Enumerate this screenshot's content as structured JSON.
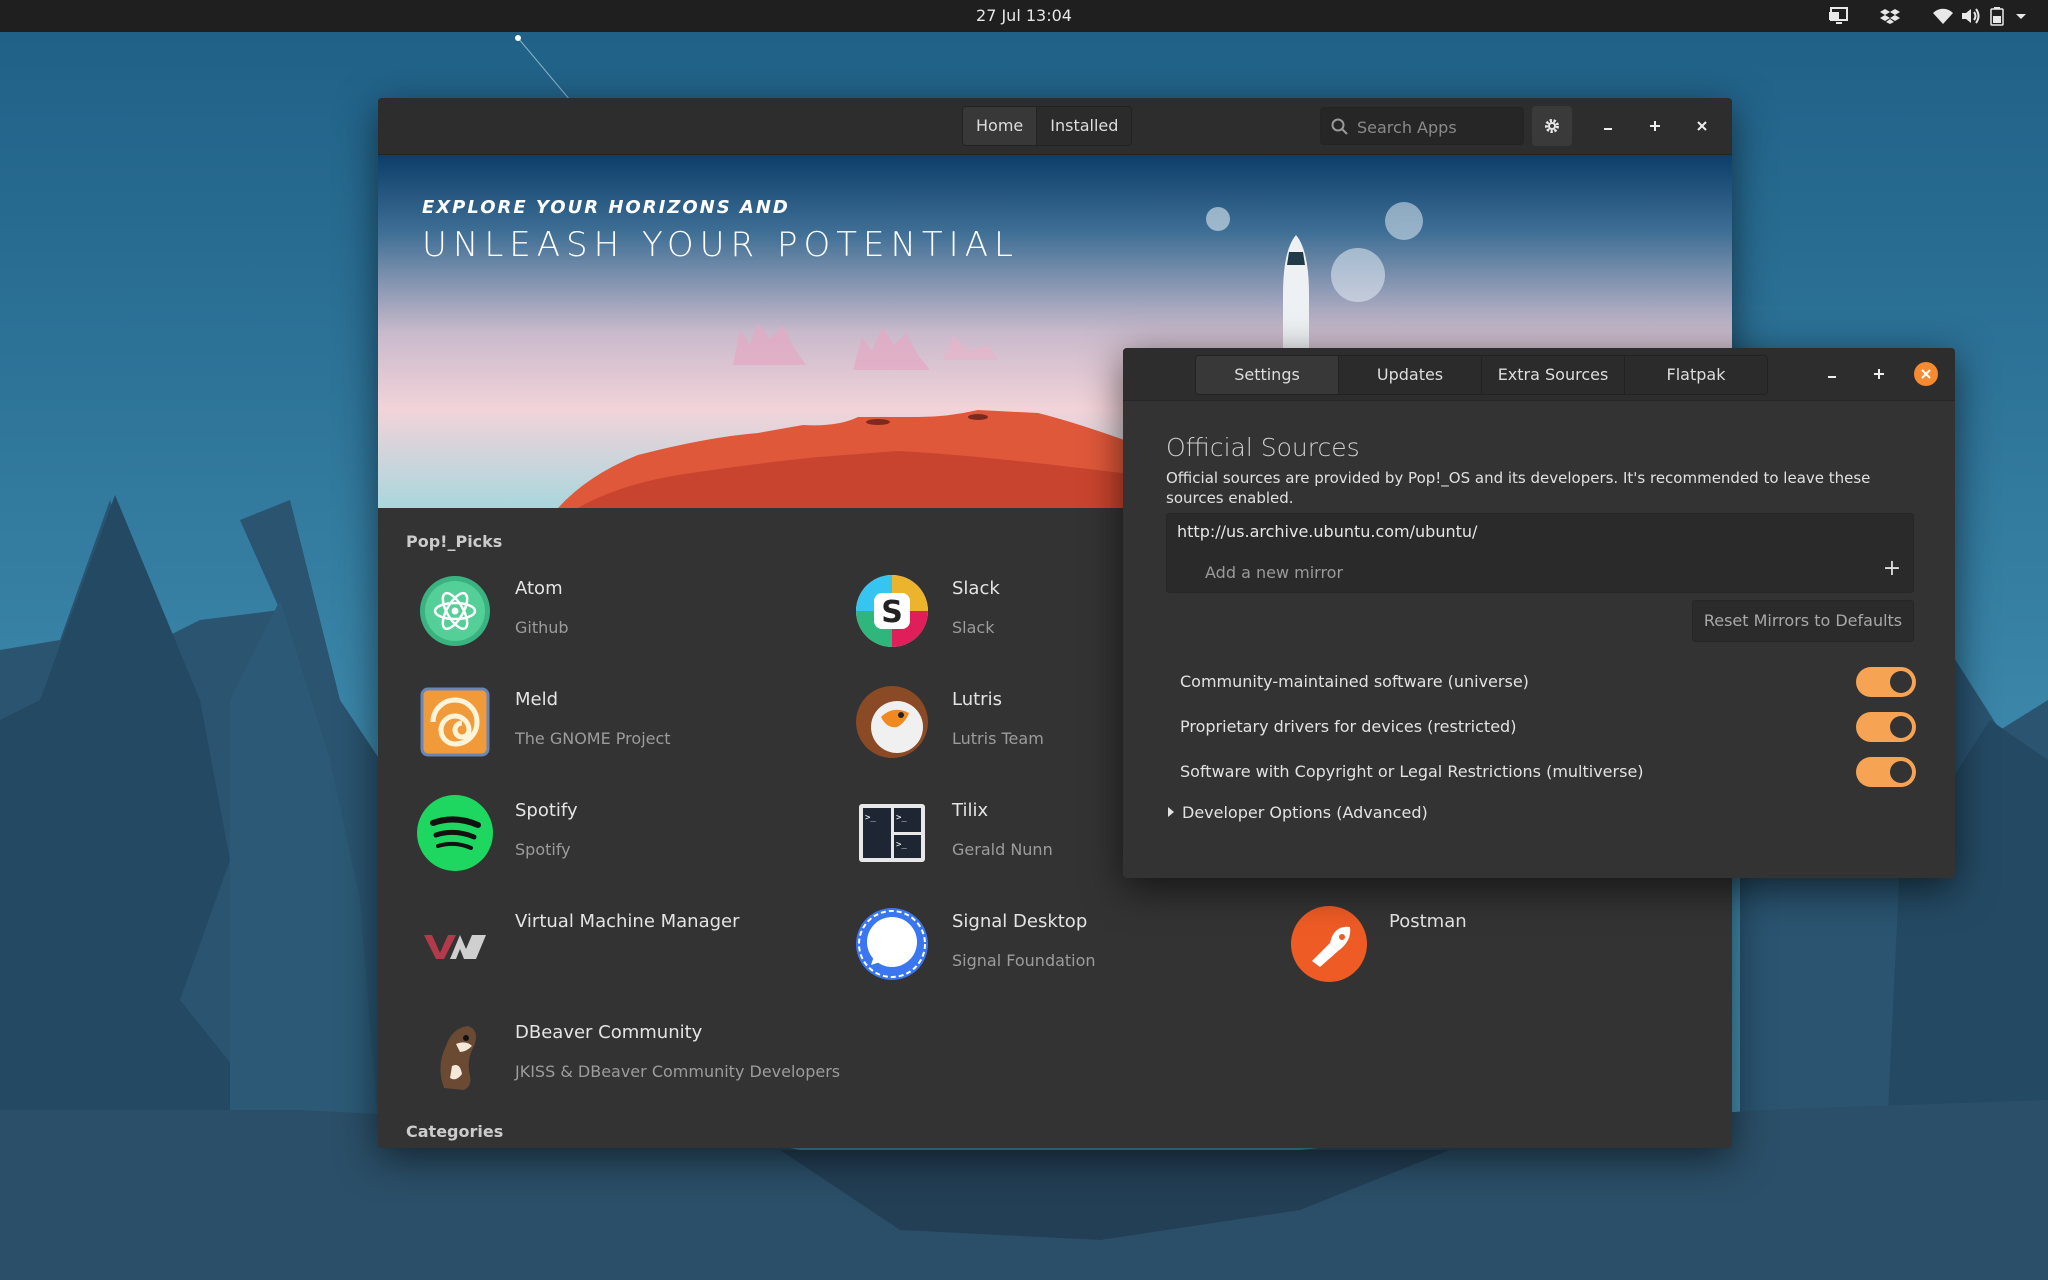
{
  "topbar": {
    "clock": "27 Jul  13:04",
    "icons": [
      "screen-icon",
      "dropbox-icon",
      "wifi-icon",
      "volume-icon",
      "battery-icon",
      "chevron-down-icon"
    ]
  },
  "main": {
    "tabs": [
      {
        "label": "Home",
        "active": true
      },
      {
        "label": "Installed",
        "active": false
      }
    ],
    "search_placeholder": "Search Apps",
    "banner": {
      "line1": "EXPLORE YOUR HORIZONS AND",
      "line2": "UNLEASH YOUR POTENTIAL"
    },
    "picks_title": "Pop!_Picks",
    "apps": [
      {
        "name": "Atom",
        "developer": "Github"
      },
      {
        "name": "Slack",
        "developer": "Slack"
      },
      {
        "name": "Meld",
        "developer": "The GNOME Project"
      },
      {
        "name": "Lutris",
        "developer": "Lutris Team"
      },
      {
        "name": "Spotify",
        "developer": "Spotify"
      },
      {
        "name": "Tilix",
        "developer": "Gerald Nunn"
      },
      {
        "name": "Virtual Machine Manager",
        "developer": ""
      },
      {
        "name": "Signal Desktop",
        "developer": "Signal Foundation"
      },
      {
        "name": "Postman",
        "developer": ""
      },
      {
        "name": "DBeaver Community",
        "developer": "JKISS & DBeaver Community Developers"
      }
    ],
    "categories_title": "Categories"
  },
  "settings": {
    "tabs": [
      {
        "label": "Settings",
        "active": true
      },
      {
        "label": "Updates",
        "active": false
      },
      {
        "label": "Extra Sources",
        "active": false
      },
      {
        "label": "Flatpak",
        "active": false
      }
    ],
    "title": "Official Sources",
    "description": "Official sources are provided by Pop!_OS and its developers. It's recommended to leave these sources enabled.",
    "mirror_url": "http://us.archive.ubuntu.com/ubuntu/",
    "mirror_placeholder": "Add a new mirror",
    "reset_label": "Reset Mirrors to Defaults",
    "toggles": [
      {
        "label": "Community-maintained software (universe)",
        "on": true
      },
      {
        "label": "Proprietary drivers for devices (restricted)",
        "on": true
      },
      {
        "label": "Software with Copyright or Legal Restrictions (multiverse)",
        "on": true
      }
    ],
    "dev_options": "Developer Options (Advanced)",
    "accent_color": "#f6a353",
    "close_color": "#f58a30"
  }
}
